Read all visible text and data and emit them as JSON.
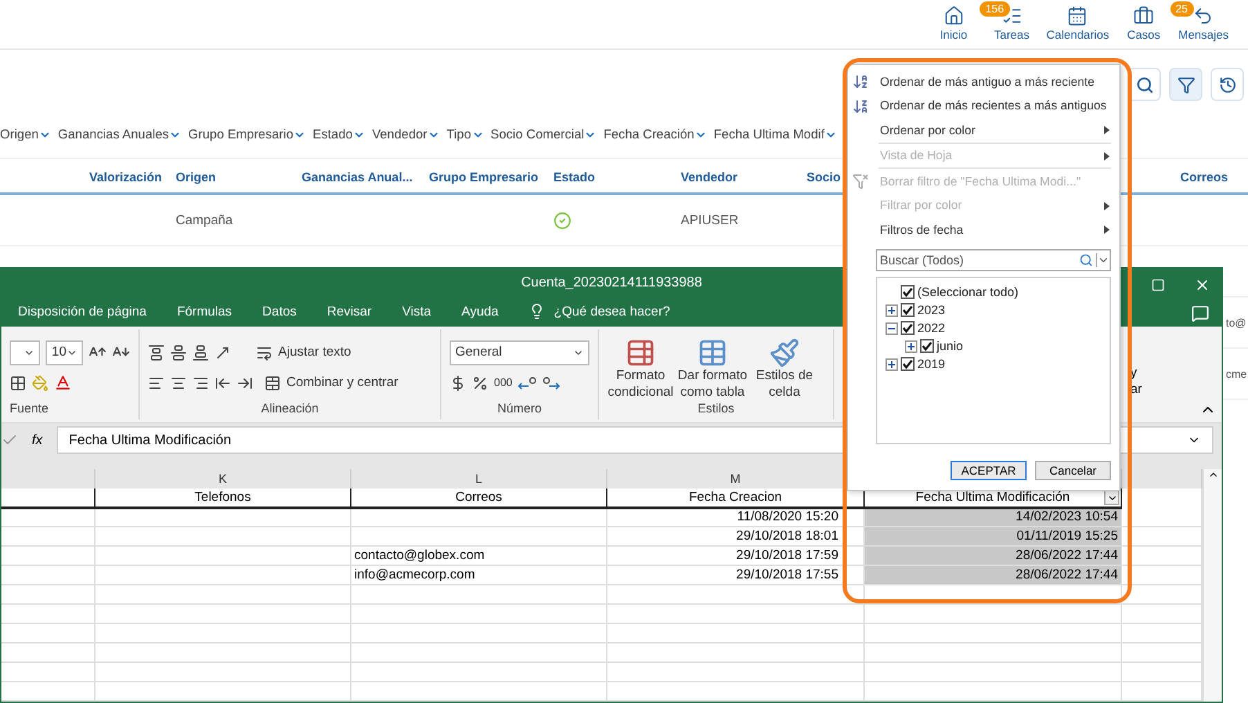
{
  "top_nav": [
    {
      "label": "Inicio"
    },
    {
      "label": "Tareas",
      "badge": "156"
    },
    {
      "label": "Calendarios"
    },
    {
      "label": "Casos"
    },
    {
      "label": "Mensajes",
      "badge": "25"
    }
  ],
  "filter_bar": [
    "Origen",
    "Ganancias Anuales",
    "Grupo Empresario",
    "Estado",
    "Vendedor",
    "Tipo",
    "Socio Comercial",
    "Fecha Creación",
    "Fecha Ultima Modif"
  ],
  "table": {
    "columns": [
      "Valorización",
      "Origen",
      "Ganancias Anual...",
      "Grupo Empresario",
      "Estado",
      "Vendedor",
      "Socio",
      "Correos"
    ],
    "rows": [
      {
        "origen": "Campaña",
        "estado_ok": true,
        "vendedor": "APIUSER"
      },
      {},
      {
        "correos": "to@"
      },
      {
        "correos": "cme"
      }
    ]
  },
  "excel": {
    "title": "Cuenta_20230214111933988",
    "tabs": [
      "Disposición de página",
      "Fórmulas",
      "Datos",
      "Revisar",
      "Vista",
      "Ayuda"
    ],
    "tell_me": "¿Qué desea hacer?",
    "ribbon": {
      "font_size": "10",
      "wrap_text": "Ajustar texto",
      "merge": "Combinar y centrar",
      "number_format": "General",
      "thousands": "000",
      "groups": [
        "Fuente",
        "Alineación",
        "Número",
        "Estilos"
      ],
      "styles": [
        {
          "line1": "Formato",
          "line2": "condicional"
        },
        {
          "line1": "Dar formato",
          "line2": "como tabla"
        },
        {
          "line1": "Estilos de",
          "line2": "celda"
        }
      ],
      "find_fragment": [
        "y",
        "ar"
      ]
    },
    "fx": "fx",
    "formula": "Fecha Ultima Modificación",
    "columns": [
      {
        "letter": "K",
        "header": "Telefonos",
        "selected": false,
        "filter_button": false
      },
      {
        "letter": "L",
        "header": "Correos",
        "selected": false,
        "filter_button": false
      },
      {
        "letter": "M",
        "header": "Fecha Creacion",
        "selected": false,
        "filter_button": false
      },
      {
        "header": "Fecha Ultima Modificación",
        "selected": true,
        "filter_button": true
      }
    ],
    "rows": [
      {
        "fecha_creacion": "11/08/2020 15:20",
        "fecha_modificacion": "14/02/2023 10:54"
      },
      {
        "fecha_creacion": "29/10/2018 18:01",
        "fecha_modificacion": "01/11/2019 15:25"
      },
      {
        "correos": "contacto@globex.com",
        "fecha_creacion": "29/10/2018 17:59",
        "fecha_modificacion": "28/06/2022 17:44"
      },
      {
        "correos": "info@acmecorp.com",
        "fecha_creacion": "29/10/2018 17:55",
        "fecha_modificacion": "28/06/2022 17:44"
      }
    ]
  },
  "filter_menu": {
    "items": [
      {
        "kind": "sort_asc",
        "label": "Ordenar de más antiguo a más reciente",
        "disabled": false,
        "submenu": false
      },
      {
        "kind": "sort_desc",
        "label": "Ordenar de más recientes a más antiguos",
        "disabled": false,
        "submenu": false
      },
      {
        "kind": "item",
        "label": "Ordenar por color",
        "disabled": false,
        "submenu": true
      },
      {
        "kind": "separator"
      },
      {
        "kind": "item",
        "label": "Vista de Hoja",
        "disabled": true,
        "submenu": true
      },
      {
        "kind": "separator"
      },
      {
        "kind": "clear_filter",
        "label": "Borrar filtro de \"Fecha Ultima Modi...\"",
        "disabled": true,
        "submenu": false
      },
      {
        "kind": "item",
        "label": "Filtrar por color",
        "disabled": true,
        "submenu": true
      },
      {
        "kind": "item",
        "label": "Filtros de fecha",
        "disabled": false,
        "submenu": true
      }
    ],
    "search": {
      "placeholder": "Buscar (Todos)"
    },
    "tree": [
      {
        "label": "(Seleccionar todo)",
        "checked": true
      },
      {
        "label": "2023",
        "checked": true,
        "expanded": false
      },
      {
        "label": "2022",
        "checked": true,
        "expanded": true,
        "children": [
          {
            "label": "junio",
            "checked": true,
            "expanded": false
          }
        ]
      },
      {
        "label": "2019",
        "checked": true,
        "expanded": false
      }
    ],
    "buttons": [
      {
        "label": "ACEPTAR",
        "default": true
      },
      {
        "label": "Cancelar",
        "default": false
      }
    ]
  }
}
